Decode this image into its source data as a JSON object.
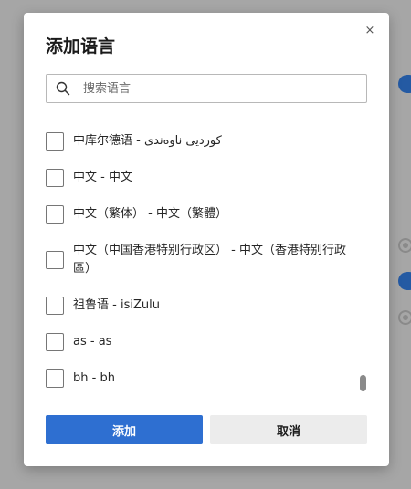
{
  "dialog": {
    "title": "添加语言",
    "close_glyph": "×",
    "search": {
      "placeholder": "搜索语言",
      "value": ""
    },
    "languages": [
      {
        "label": "中库尔德语 - کوردیی ناوەندی",
        "checked": false
      },
      {
        "label": "中文 - 中文",
        "checked": false
      },
      {
        "label": "中文（繁体） - 中文（繁體）",
        "checked": false
      },
      {
        "label": "中文（中国香港特别行政区） - 中文（香港特别行政區）",
        "checked": false
      },
      {
        "label": "祖鲁语 - isiZulu",
        "checked": false
      },
      {
        "label": "as - as",
        "checked": false
      },
      {
        "label": "bh - bh",
        "checked": false
      }
    ],
    "buttons": {
      "add": "添加",
      "cancel": "取消"
    }
  },
  "colors": {
    "primary": "#2e6fd1",
    "secondary_button": "#ececec",
    "overlay": "#a6a6a6",
    "background_toggle": "#245aa3"
  }
}
